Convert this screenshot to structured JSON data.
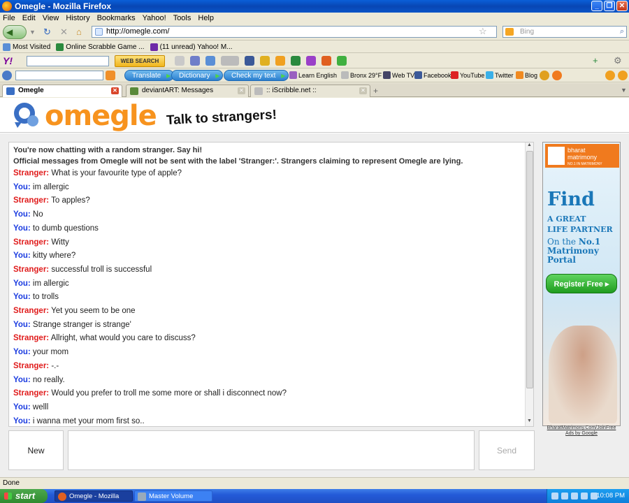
{
  "window": {
    "title": "Omegle - Mozilla Firefox"
  },
  "menu": [
    "File",
    "Edit",
    "View",
    "History",
    "Bookmarks",
    "Yahoo!",
    "Tools",
    "Help"
  ],
  "nav": {
    "url": "http://omegle.com/",
    "search_placeholder": "Bing"
  },
  "bookmarks": [
    "Most Visited",
    "Online Scrabble Game ...",
    "(11 unread) Yahoo! M..."
  ],
  "yahoo_toolbar": {
    "logo": "Y!",
    "web_search": "WEB SEARCH"
  },
  "translate_toolbar": {
    "translate": "Translate",
    "dictionary": "Dictionary",
    "check_text": "Check my text",
    "learn_english": "Learn English",
    "weather": "Bronx 29°F",
    "web_tv": "Web TV",
    "facebook": "Facebook",
    "youtube": "YouTube",
    "twitter": "Twitter",
    "blog": "Blog"
  },
  "tabs": [
    {
      "label": "Omegle",
      "active": true
    },
    {
      "label": "deviantART: Messages",
      "active": false
    },
    {
      "label": ":: iScribble.net ::",
      "active": false
    }
  ],
  "page": {
    "logo": "omegle",
    "tagline": "Talk to strangers!",
    "system_messages": [
      "You're now chatting with a random stranger. Say hi!",
      "Official messages from Omegle will not be sent with the label 'Stranger:'. Strangers claiming to represent Omegle are lying."
    ],
    "messages": [
      {
        "who": "Stranger:",
        "text": "What is your favourite type of apple?"
      },
      {
        "who": "You:",
        "text": "im allergic"
      },
      {
        "who": "Stranger:",
        "text": "To apples?"
      },
      {
        "who": "You:",
        "text": "No"
      },
      {
        "who": "You:",
        "text": "to dumb questions"
      },
      {
        "who": "Stranger:",
        "text": "Witty"
      },
      {
        "who": "You:",
        "text": "kitty where?"
      },
      {
        "who": "Stranger:",
        "text": "successful troll is successful"
      },
      {
        "who": "You:",
        "text": "im allergic"
      },
      {
        "who": "You:",
        "text": "to trolls"
      },
      {
        "who": "Stranger:",
        "text": "Yet you seem to be one"
      },
      {
        "who": "You:",
        "text": "Strange stranger is strange'"
      },
      {
        "who": "Stranger:",
        "text": "Allright, what would you care to discuss?"
      },
      {
        "who": "You:",
        "text": "your mom"
      },
      {
        "who": "Stranger:",
        "text": "-.-"
      },
      {
        "who": "You:",
        "text": "no really."
      },
      {
        "who": "Stranger:",
        "text": "Would you prefer to troll me some more or shall i disconnect now?"
      },
      {
        "who": "You:",
        "text": "welll"
      },
      {
        "who": "You:",
        "text": "i wanna met your mom first so.."
      }
    ],
    "new_button": "New",
    "send_button": "Send"
  },
  "ad": {
    "brand_line1": "bharat",
    "brand_line2": "matrimony",
    "brand_line3": "NO.1 IN MATRIMONY",
    "find": "Find",
    "great_line1": "A GREAT",
    "great_line2": "LIFE PARTNER",
    "on_the": "On the",
    "no1": "No.1",
    "matrimony": "Matrimony",
    "portal": "Portal",
    "register": "Register Free",
    "link": "BharatMatrimony.Com/JoinFree",
    "ads_by": "Ads by Google"
  },
  "status": "Done",
  "taskbar": {
    "start": "start",
    "tasks": [
      "Omegle - Mozilla Firefox",
      "Master Volume"
    ],
    "clock": "10:08 PM"
  },
  "colors": {
    "stranger": "#e01b1b",
    "you": "#1b3ce0",
    "omegle_orange": "#f7931e",
    "omegle_blue": "#3a6fc4"
  }
}
